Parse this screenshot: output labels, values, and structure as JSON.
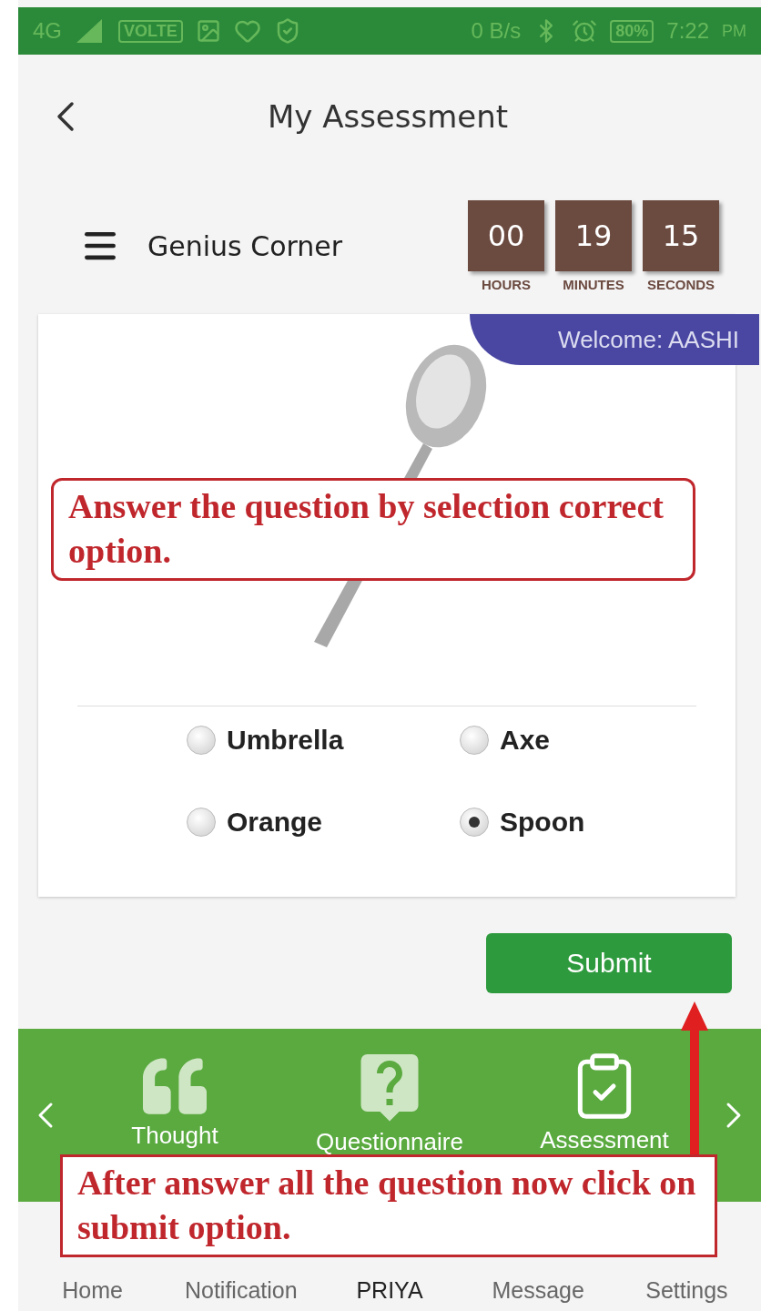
{
  "status_bar": {
    "network": "4G",
    "volte": "VOLTE",
    "speed": "0 B/s",
    "battery": "80%",
    "time": "7:22",
    "period": "PM"
  },
  "header": {
    "title": "My Assessment"
  },
  "section": {
    "title": "Genius Corner"
  },
  "timer": [
    {
      "value": "00",
      "label": "HOURS"
    },
    {
      "value": "19",
      "label": "MINUTES"
    },
    {
      "value": "15",
      "label": "SECONDS"
    }
  ],
  "welcome": "Welcome: AASHI",
  "options": [
    {
      "label": "Umbrella",
      "selected": false
    },
    {
      "label": "Axe",
      "selected": false
    },
    {
      "label": "Orange",
      "selected": false
    },
    {
      "label": "Spoon",
      "selected": true
    }
  ],
  "submit": "Submit",
  "carousel": [
    {
      "kind": "quote",
      "label": "Thought"
    },
    {
      "kind": "question",
      "label": "Questionnaire"
    },
    {
      "kind": "clipboard",
      "label": "Assessment"
    }
  ],
  "bottom_nav": [
    {
      "label": "Home",
      "selected": false
    },
    {
      "label": "Notification",
      "selected": false
    },
    {
      "label": "PRIYA",
      "selected": true
    },
    {
      "label": "Message",
      "selected": false
    },
    {
      "label": "Settings",
      "selected": false
    }
  ],
  "callouts": [
    {
      "text": "Answer the question by selection correct option."
    },
    {
      "text": "After answer all the question now click on submit option."
    }
  ]
}
